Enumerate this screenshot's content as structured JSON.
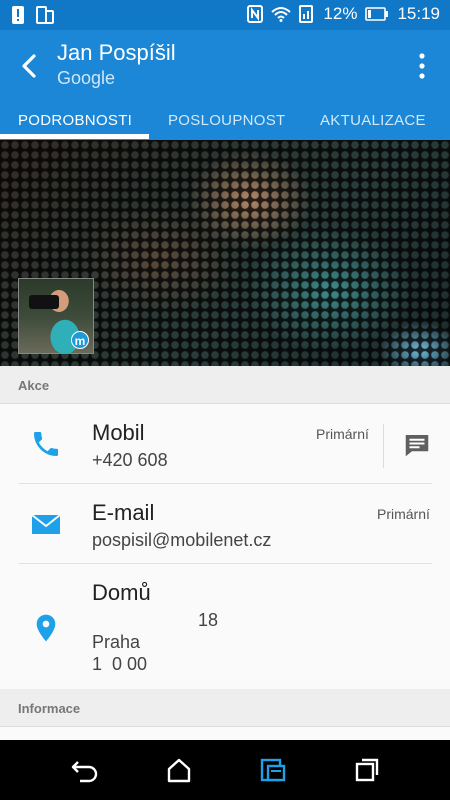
{
  "status_bar": {
    "battery_percent": "12%",
    "time": "15:19",
    "icons": [
      "alert-icon",
      "sim-icon",
      "nfc-icon",
      "wifi-icon",
      "signal-icon",
      "battery-icon"
    ]
  },
  "app_bar": {
    "title": "Jan Pospíšil",
    "subtitle": "Google",
    "icons": [
      "back-arrow-icon",
      "more-vert-icon"
    ]
  },
  "tabs": [
    {
      "label": "PODROBNOSTI",
      "active": true
    },
    {
      "label": "POSLOUPNOST",
      "active": false
    },
    {
      "label": "AKTUALIZACE",
      "active": false
    }
  ],
  "avatar": {
    "badge": "m"
  },
  "sections": {
    "actions_header": "Akce",
    "info_header": "Informace"
  },
  "contacts": {
    "mobile": {
      "title": "Mobil",
      "value": "+420 608",
      "tag": "Primární",
      "icon": "phone-icon",
      "action_icon": "message-icon"
    },
    "email": {
      "title": "E-mail",
      "value": "pospisil@mobilenet.cz",
      "tag": "Primární",
      "icon": "mail-icon"
    },
    "home": {
      "title": "Domů",
      "line1": "18",
      "line2": "Praha",
      "line3": "1  0 00",
      "icon": "location-pin-icon"
    }
  },
  "nav_bar": {
    "icons": [
      "back-icon",
      "home-icon",
      "blinkfeed-icon",
      "recents-icon"
    ]
  },
  "colors": {
    "accent": "#1b87d6",
    "status_bar": "#1177c7",
    "icon_blue": "#1ea1e8"
  }
}
